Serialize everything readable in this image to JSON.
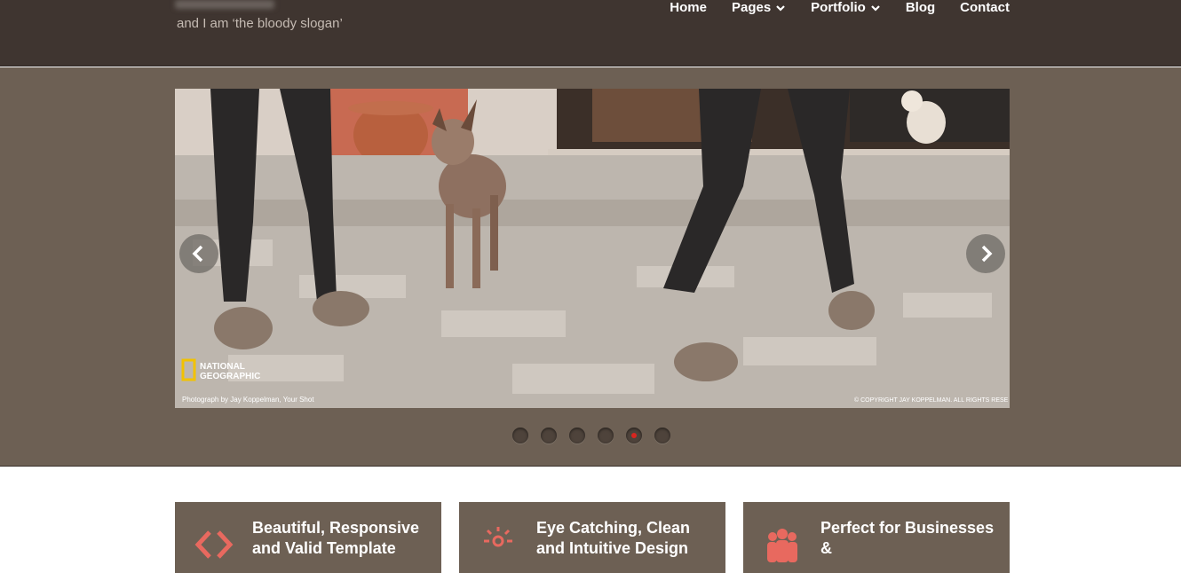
{
  "header": {
    "slogan": "and I am ‘the bloody slogan’",
    "nav": [
      {
        "label": "Home",
        "has_dropdown": false
      },
      {
        "label": "Pages",
        "has_dropdown": true
      },
      {
        "label": "Portfolio",
        "has_dropdown": true
      },
      {
        "label": "Blog",
        "has_dropdown": false
      },
      {
        "label": "Contact",
        "has_dropdown": false
      }
    ]
  },
  "slider": {
    "brand_text_line1": "NATIONAL",
    "brand_text_line2": "GEOGRAPHIC",
    "photo_credit": "Photograph by Jay Koppelman, Your Shot",
    "copyright": "© COPYRIGHT JAY KOPPELMAN. ALL RIGHTS RESE",
    "prev_icon": "chevron-left-icon",
    "next_icon": "chevron-right-icon",
    "dot_count": 6,
    "active_dot": 5
  },
  "features": [
    {
      "icon": "code-icon",
      "title": "Beautiful, Responsive and Valid Template"
    },
    {
      "icon": "sun-icon",
      "title": "Eye Catching, Clean and Intuitive Design"
    },
    {
      "icon": "users-icon",
      "title": "Perfect for Businesses &"
    }
  ],
  "colors": {
    "header_bg": "#3f3530",
    "hero_bg": "#6d6054",
    "accent": "#e8695f",
    "active_dot": "#d8251f"
  }
}
